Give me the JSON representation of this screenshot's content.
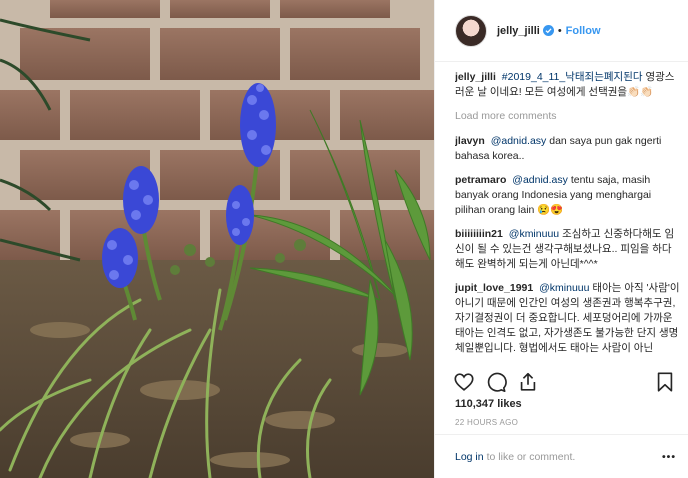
{
  "post": {
    "username": "jelly_jilli",
    "follow_label": "Follow",
    "separator": "•",
    "caption_user": "jelly_jilli",
    "caption_hashtag": "#2019_4_11_낙태죄는폐지된다",
    "caption_text": "영광스러운 날 이네요! 모든 여성에게 선택권을👏🏻👏🏻",
    "load_more_label": "Load more comments",
    "likes": "110,347 likes",
    "time_ago": "22 HOURS AGO",
    "login_label": "Log in",
    "login_suffix": "to like or comment.",
    "more_label": "•••"
  },
  "comments": [
    {
      "user": "jlavyn",
      "mention": "@adnid.asy",
      "text": "dan saya pun gak ngerti bahasa korea.."
    },
    {
      "user": "petramaro",
      "mention": "@adnid.asy",
      "text": "tentu saja, masih banyak orang Indonesia yang menghargai pilihan orang lain 😢😍"
    },
    {
      "user": "biiiiiiiin21",
      "mention": "@kminuuu",
      "text": "조심하고 신중하다해도 임신이 될 수 있는건 생각구해보셨나요.. 피임을 하다해도 완벽하게 되는게 아닌데*^^*"
    },
    {
      "user": "jupit_love_1991",
      "mention": "@kminuuu",
      "text": "태아는 아직 '사람'이 아니기 때문에 인간인 여성의 생존권과 행복추구권, 자기결정권이 더 중요합니다. 세포덩어리에 가까운 태아는 인격도 없고, 자가생존도 불가능한 단지 생명체일뿐입니다. 형법에서도 태아는 사람이 아닌"
    }
  ],
  "icons": [
    "verified-icon",
    "heart-icon",
    "comment-icon",
    "share-icon",
    "bookmark-icon"
  ],
  "colors": {
    "link": "#3897f0",
    "tag": "#003569",
    "muted": "#999999"
  }
}
